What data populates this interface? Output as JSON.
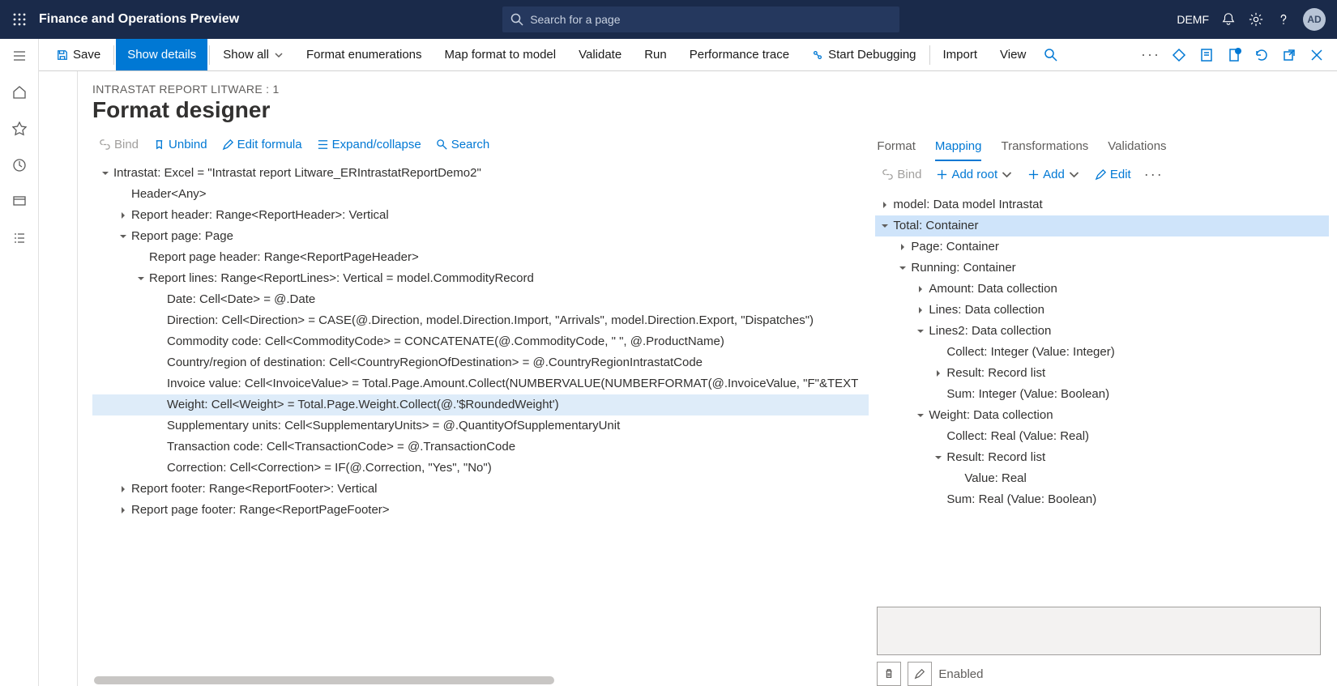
{
  "top": {
    "app_title": "Finance and Operations Preview",
    "search_placeholder": "Search for a page",
    "company": "DEMF",
    "avatar": "AD"
  },
  "actions": {
    "save": "Save",
    "show_details": "Show details",
    "show_all": "Show all",
    "format_enum": "Format enumerations",
    "map_format": "Map format to model",
    "validate": "Validate",
    "run": "Run",
    "perf": "Performance trace",
    "debug": "Start Debugging",
    "import": "Import",
    "view": "View"
  },
  "breadcrumb": "INTRASTAT REPORT LITWARE : 1",
  "page_title": "Format designer",
  "left_tools": {
    "bind": "Bind",
    "unbind": "Unbind",
    "edit_formula": "Edit formula",
    "expand": "Expand/collapse",
    "search": "Search"
  },
  "format_tree": [
    {
      "indent": 0,
      "tw": "open",
      "text": "Intrastat: Excel = \"Intrastat report Litware_ERIntrastatReportDemo2\""
    },
    {
      "indent": 1,
      "tw": "none",
      "text": "Header<Any>"
    },
    {
      "indent": 1,
      "tw": "closed",
      "text": "Report header: Range<ReportHeader>: Vertical"
    },
    {
      "indent": 1,
      "tw": "open",
      "text": "Report page: Page"
    },
    {
      "indent": 2,
      "tw": "none",
      "text": "Report page header: Range<ReportPageHeader>"
    },
    {
      "indent": 2,
      "tw": "open",
      "text": "Report lines: Range<ReportLines>: Vertical = model.CommodityRecord"
    },
    {
      "indent": 3,
      "tw": "none",
      "text": "Date: Cell<Date> = @.Date"
    },
    {
      "indent": 3,
      "tw": "none",
      "text": "Direction: Cell<Direction> = CASE(@.Direction, model.Direction.Import, \"Arrivals\", model.Direction.Export, \"Dispatches\")"
    },
    {
      "indent": 3,
      "tw": "none",
      "text": "Commodity code: Cell<CommodityCode> = CONCATENATE(@.CommodityCode, \" \", @.ProductName)"
    },
    {
      "indent": 3,
      "tw": "none",
      "text": "Country/region of destination: Cell<CountryRegionOfDestination> = @.CountryRegionIntrastatCode"
    },
    {
      "indent": 3,
      "tw": "none",
      "text": "Invoice value: Cell<InvoiceValue> = Total.Page.Amount.Collect(NUMBERVALUE(NUMBERFORMAT(@.InvoiceValue, \"F\"&TEXT"
    },
    {
      "indent": 3,
      "tw": "none",
      "text": "Weight: Cell<Weight> = Total.Page.Weight.Collect(@.'$RoundedWeight')",
      "sel": true
    },
    {
      "indent": 3,
      "tw": "none",
      "text": "Supplementary units: Cell<SupplementaryUnits> = @.QuantityOfSupplementaryUnit"
    },
    {
      "indent": 3,
      "tw": "none",
      "text": "Transaction code: Cell<TransactionCode> = @.TransactionCode"
    },
    {
      "indent": 3,
      "tw": "none",
      "text": "Correction: Cell<Correction> = IF(@.Correction, \"Yes\", \"No\")"
    },
    {
      "indent": 1,
      "tw": "closed",
      "text": "Report footer: Range<ReportFooter>: Vertical"
    },
    {
      "indent": 1,
      "tw": "closed",
      "text": "Report page footer: Range<ReportPageFooter>"
    }
  ],
  "right_tabs": {
    "format": "Format",
    "mapping": "Mapping",
    "transformations": "Transformations",
    "validations": "Validations"
  },
  "right_tools": {
    "bind": "Bind",
    "add_root": "Add root",
    "add": "Add",
    "edit": "Edit"
  },
  "mapping_tree": [
    {
      "indent": 0,
      "tw": "closed",
      "text": "model: Data model Intrastat"
    },
    {
      "indent": 0,
      "tw": "open",
      "text": "Total: Container",
      "sel": true
    },
    {
      "indent": 1,
      "tw": "closed",
      "text": "Page: Container"
    },
    {
      "indent": 1,
      "tw": "open",
      "text": "Running: Container"
    },
    {
      "indent": 2,
      "tw": "closed",
      "text": "Amount: Data collection"
    },
    {
      "indent": 2,
      "tw": "closed",
      "text": "Lines: Data collection"
    },
    {
      "indent": 2,
      "tw": "open",
      "text": "Lines2: Data collection"
    },
    {
      "indent": 3,
      "tw": "none",
      "text": "Collect: Integer (Value: Integer)"
    },
    {
      "indent": 3,
      "tw": "closed",
      "text": "Result: Record list"
    },
    {
      "indent": 3,
      "tw": "none",
      "text": "Sum: Integer (Value: Boolean)"
    },
    {
      "indent": 2,
      "tw": "open",
      "text": "Weight: Data collection"
    },
    {
      "indent": 3,
      "tw": "none",
      "text": "Collect: Real (Value: Real)"
    },
    {
      "indent": 3,
      "tw": "open",
      "text": "Result: Record list"
    },
    {
      "indent": 4,
      "tw": "none",
      "text": "Value: Real"
    },
    {
      "indent": 3,
      "tw": "none",
      "text": "Sum: Real (Value: Boolean)"
    }
  ],
  "enabled_label": "Enabled"
}
